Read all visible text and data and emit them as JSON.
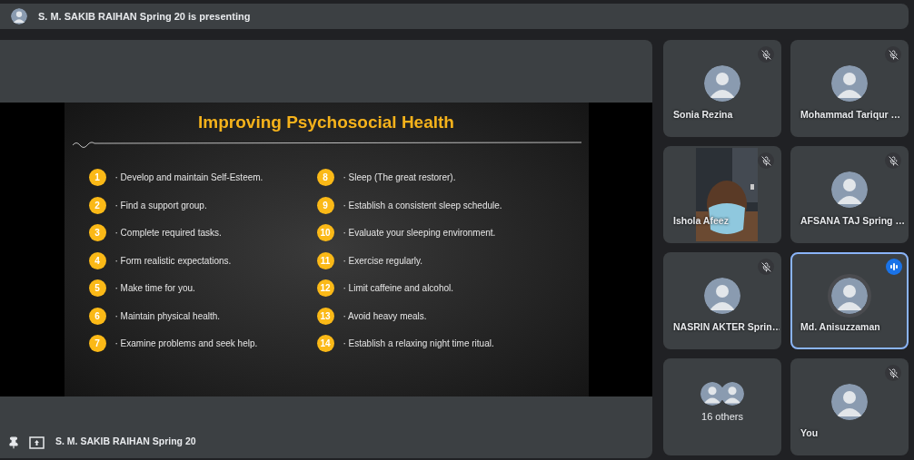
{
  "banner": {
    "text": "S. M. SAKIB RAIHAN Spring 20 is presenting"
  },
  "slide": {
    "title": "Improving Psychosocial Health",
    "columns": [
      [
        {
          "number": "1",
          "text": "· Develop and maintain Self-Esteem."
        },
        {
          "number": "2",
          "text": "· Find a support group."
        },
        {
          "number": "3",
          "text": "· Complete required tasks."
        },
        {
          "number": "4",
          "text": "· Form realistic expectations."
        },
        {
          "number": "5",
          "text": "· Make time for you."
        },
        {
          "number": "6",
          "text": "· Maintain physical health."
        },
        {
          "number": "7",
          "text": "· Examine problems and seek help."
        }
      ],
      [
        {
          "number": "8",
          "text": "· Sleep (The great restorer)."
        },
        {
          "number": "9",
          "text": "· Establish a consistent sleep schedule."
        },
        {
          "number": "10",
          "text": "· Evaluate your sleeping environment."
        },
        {
          "number": "11",
          "text": "· Exercise regularly."
        },
        {
          "number": "12",
          "text": "· Limit caffeine and alcohol."
        },
        {
          "number": "13",
          "text": "· Avoid heavy meals."
        },
        {
          "number": "14",
          "text": "· Establish a relaxing night time ritual."
        }
      ]
    ]
  },
  "presenter_bar": {
    "pinned": true,
    "name": "S. M. SAKIB RAIHAN Spring 20"
  },
  "participants": [
    {
      "kind": "avatar",
      "name": "Sonia Rezina",
      "muted": true,
      "speaking": false
    },
    {
      "kind": "avatar",
      "name": "Mohammad Tariqur …",
      "muted": true,
      "speaking": false
    },
    {
      "kind": "video",
      "name": "Ishola Afeez",
      "muted": true,
      "speaking": false
    },
    {
      "kind": "avatar",
      "name": "AFSANA TAJ Spring …",
      "muted": true,
      "speaking": false
    },
    {
      "kind": "avatar",
      "name": "NASRIN AKTER Sprin…",
      "muted": true,
      "speaking": false
    },
    {
      "kind": "avatar",
      "name": "Md. Anisuzzaman",
      "muted": false,
      "speaking": true
    },
    {
      "kind": "others",
      "name": "16 others",
      "muted": false,
      "speaking": false
    },
    {
      "kind": "avatar",
      "name": "You",
      "muted": true,
      "speaking": false
    }
  ]
}
